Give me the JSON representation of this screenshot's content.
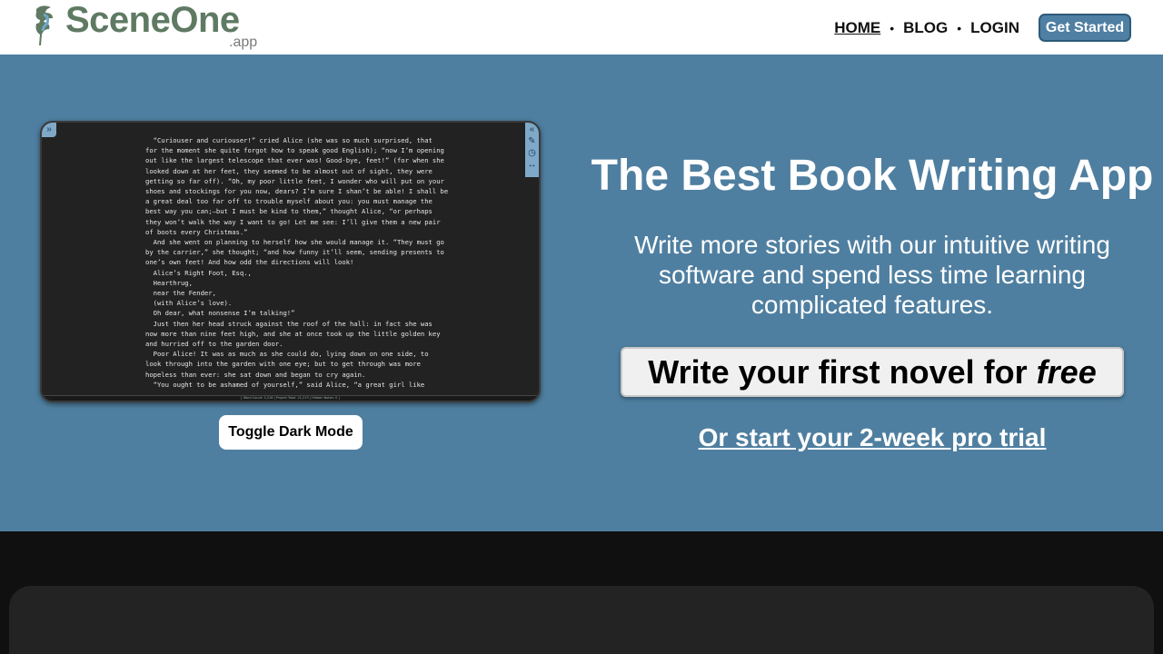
{
  "header": {
    "logo_text": "SceneOne",
    "logo_sub": ".app",
    "nav": [
      {
        "label": "HOME",
        "active": true
      },
      {
        "label": "BLOG",
        "active": false
      },
      {
        "label": "LOGIN",
        "active": false
      }
    ],
    "separator": "•",
    "cta_label": "Get Started"
  },
  "hero": {
    "title": "The Best Book Writing App",
    "subtitle": "Write more stories with our intuitive writing software and spend less time learning complicated features.",
    "free_button_prefix": "Write your first novel for",
    "free_button_emphasis": "free",
    "trial_link": "Or start your 2-week pro trial",
    "toggle_label": "Toggle Dark Mode",
    "editor_text": "  “Curiouser and curiouser!” cried Alice (she was so much surprised, that\nfor the moment she quite forgot how to speak good English); “now I’m opening\nout like the largest telescope that ever was! Good-bye, feet!” (for when she\nlooked down at her feet, they seemed to be almost out of sight, they were\ngetting so far off). “Oh, my poor little feet, I wonder who will put on your\nshoes and stockings for you now, dears? I’m sure I shan’t be able! I shall be\na great deal too far off to trouble myself about you: you must manage the\nbest way you can;—but I must be kind to them,” thought Alice, “or perhaps\nthey won’t walk the way I want to go! Let me see: I’ll give them a new pair\nof boots every Christmas.”\n  And she went on planning to herself how she would manage it. “They must go\nby the carrier,” she thought; “and how funny it’ll seem, sending presents to\none’s own feet! And how odd the directions will look!\n  Alice’s Right Foot, Esq.,\n  Hearthrug,\n  near the Fender,\n  (with Alice’s love).\n  Oh dear, what nonsense I’m talking!”\n  Just then her head struck against the roof of the hall: in fact she was\nnow more than nine feet high, and she at once took up the little golden key\nand hurried off to the garden door.\n  Poor Alice! It was as much as she could do, lying down on one side, to\nlook through into the garden with one eye; but to get through was more\nhopeless than ever: she sat down and began to cry again.\n  “You ought to be ashamed of yourself,” said Alice, “a great girl like",
    "editor_status": "[ Word Count: 2,216 | Project Total: 21,213 | Hidden Notes: 0 ]"
  },
  "colors": {
    "brand_green": "#5f7a63",
    "hero_bg": "#4f7fa0",
    "cta_bg": "#4f7fa3",
    "page_bg": "#101010"
  }
}
